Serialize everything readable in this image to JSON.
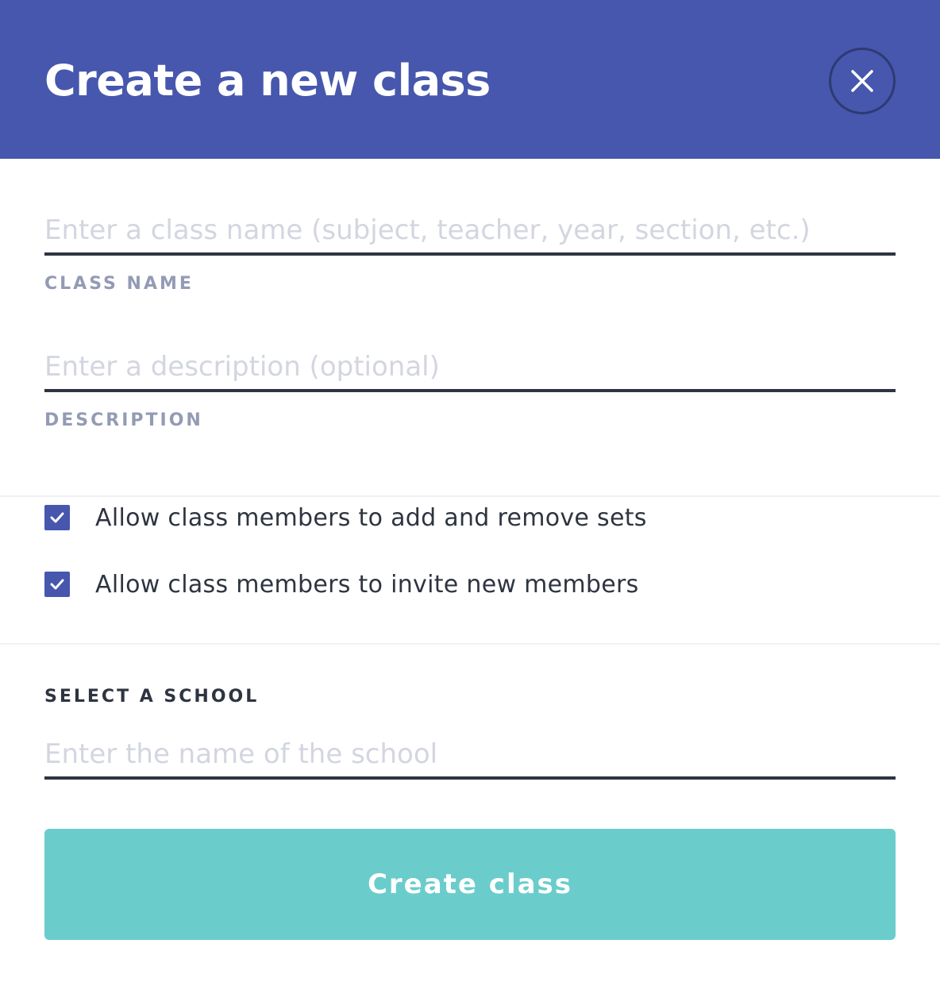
{
  "header": {
    "title": "Create a new class",
    "close_icon": "close-icon",
    "background_color": "#4657ad"
  },
  "class_name": {
    "placeholder": "Enter a class name (subject, teacher, year, section, etc.)",
    "value": "",
    "label": "CLASS NAME"
  },
  "description": {
    "placeholder": "Enter a description (optional)",
    "value": "",
    "label": "DESCRIPTION"
  },
  "options": [
    {
      "label": "Allow class members to add and remove sets",
      "checked": true,
      "icon": "checkmark-icon"
    },
    {
      "label": "Allow class members to invite new members",
      "checked": true,
      "icon": "checkmark-icon"
    }
  ],
  "school": {
    "heading": "SELECT A SCHOOL",
    "placeholder": "Enter the name of the school",
    "value": ""
  },
  "submit": {
    "label": "Create class",
    "color": "#6bcccc"
  }
}
